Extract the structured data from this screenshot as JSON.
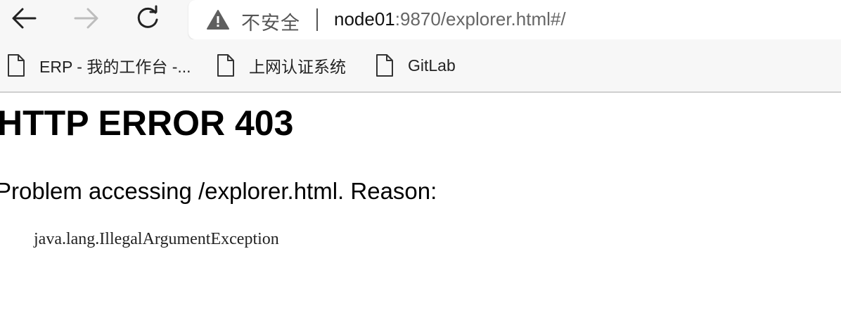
{
  "browser": {
    "nav": {
      "back_icon": "arrow-left-icon",
      "forward_icon": "arrow-right-icon",
      "reload_icon": "refresh-icon"
    },
    "address_bar": {
      "security_icon": "warning-icon",
      "security_label": "不安全",
      "url_host": "node01",
      "url_rest": ":9870/explorer.html#/"
    },
    "bookmarks": [
      {
        "label": "ERP - 我的工作台 -...",
        "icon": "page-icon"
      },
      {
        "label": "上网认证系统",
        "icon": "page-icon"
      },
      {
        "label": "GitLab",
        "icon": "page-icon"
      }
    ]
  },
  "page": {
    "title": "HTTP ERROR 403",
    "reason": "Problem accessing /explorer.html. Reason:",
    "exception": "java.lang.IllegalArgumentException"
  },
  "colors": {
    "toolbar_bg": "#f7f7f7",
    "address_bg": "#ffffff",
    "warning_icon": "#5f5f5f",
    "disabled_icon": "#bdbdbd"
  }
}
